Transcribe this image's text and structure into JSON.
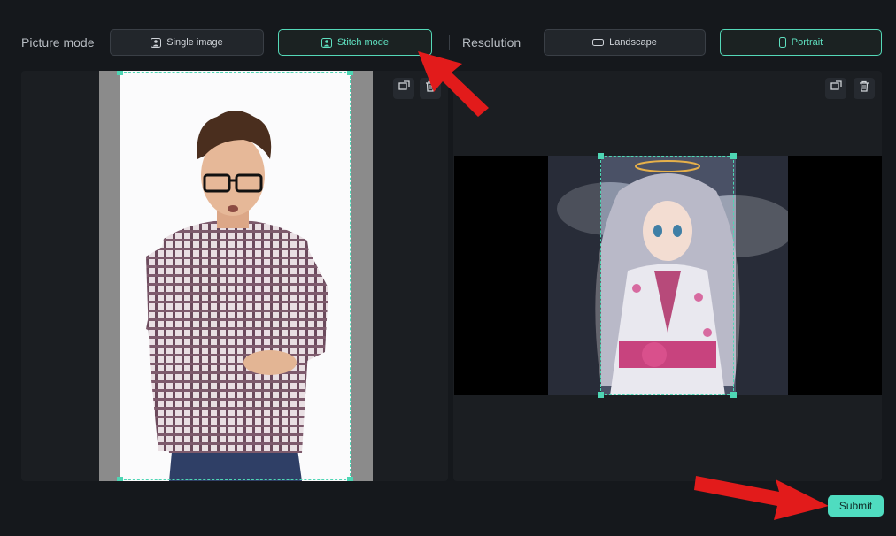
{
  "toolbar": {
    "picture_mode_label": "Picture mode",
    "single_image_label": "Single image",
    "stitch_mode_label": "Stitch mode",
    "resolution_label": "Resolution",
    "landscape_label": "Landscape",
    "portrait_label": "Portrait"
  },
  "footer": {
    "submit_label": "Submit"
  },
  "colors": {
    "accent": "#4fdcc0",
    "background": "#15181c",
    "panel": "#1b1e22",
    "annotation_arrow": "#e21b1b"
  },
  "icons": [
    "person-image-icon",
    "landscape-icon",
    "portrait-icon",
    "replace-icon",
    "trash-icon"
  ]
}
